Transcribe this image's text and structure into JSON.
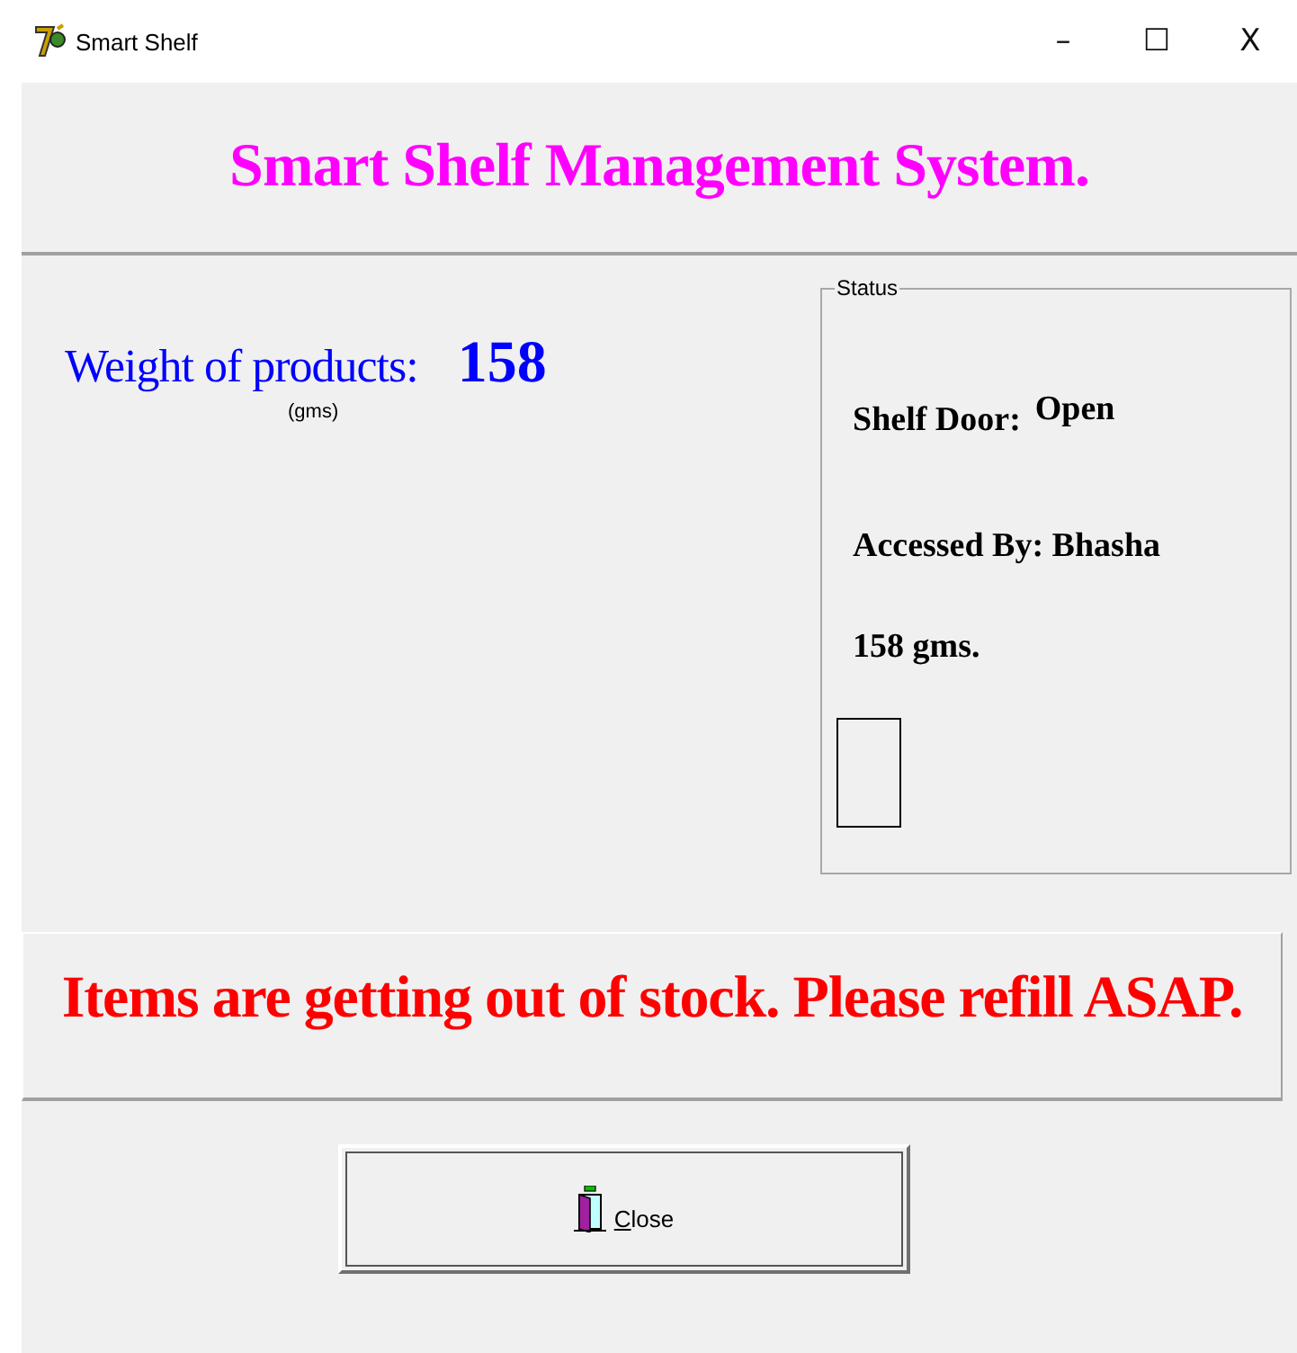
{
  "window": {
    "title": "Smart Shelf",
    "controls": [
      "–",
      "☐",
      "X"
    ]
  },
  "header": {
    "title": "Smart Shelf Management System."
  },
  "weight": {
    "label": "Weight of products:",
    "value": "158",
    "unit": "(gms)"
  },
  "status": {
    "legend": "Status",
    "door_label": "Shelf Door:",
    "door_value": "Open",
    "accessed": "Accessed By: Bhasha",
    "reading": "158 gms."
  },
  "alert": {
    "message": "Items are getting out of stock. Please refill ASAP."
  },
  "buttons": [
    {
      "label": "Close"
    }
  ]
}
